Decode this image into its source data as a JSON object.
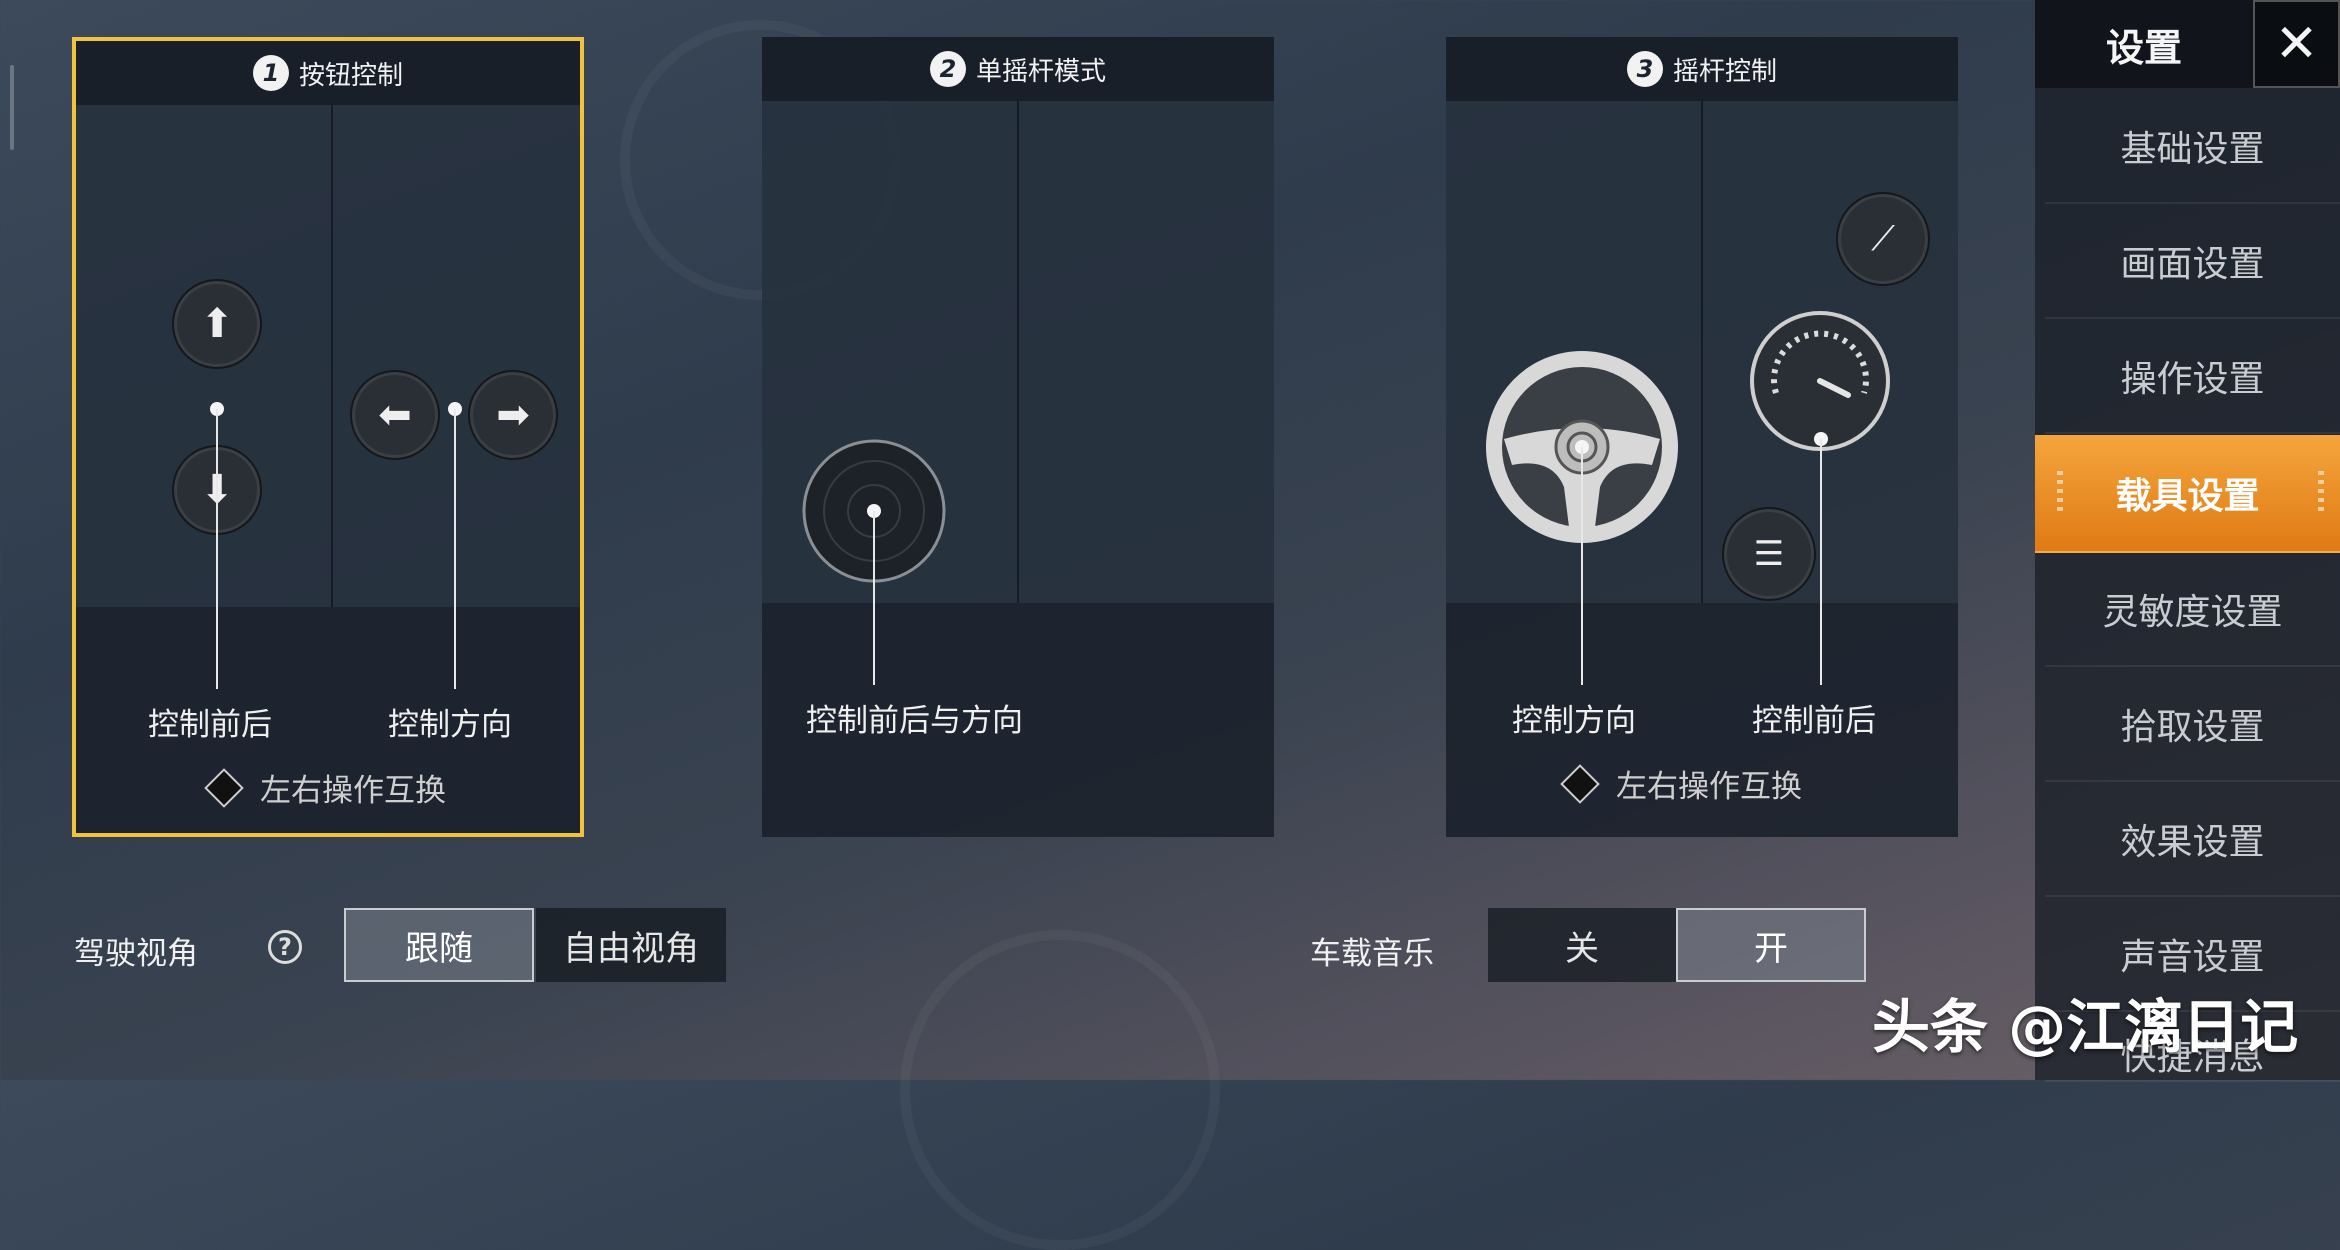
{
  "panels": [
    {
      "number": "1",
      "title": "按钮控制",
      "left_label": "控制前后",
      "right_label": "控制方向",
      "swap_label": "左右操作互换"
    },
    {
      "number": "2",
      "title": "单摇杆模式",
      "center_label": "控制前后与方向"
    },
    {
      "number": "3",
      "title": "摇杆控制",
      "left_label": "控制方向",
      "right_label": "控制前后",
      "swap_label": "左右操作互换"
    }
  ],
  "sidebar": {
    "title": "设置",
    "close_label": "✕",
    "items": [
      {
        "label": "基础设置"
      },
      {
        "label": "画面设置"
      },
      {
        "label": "操作设置"
      },
      {
        "label": "载具设置",
        "active": true
      },
      {
        "label": "灵敏度设置"
      },
      {
        "label": "拾取设置"
      },
      {
        "label": "效果设置"
      },
      {
        "label": "声音设置"
      },
      {
        "label": "快捷消息"
      }
    ]
  },
  "driving_view": {
    "label": "驾驶视角",
    "help": "?",
    "options": [
      "跟随",
      "自由视角"
    ],
    "selected": "跟随"
  },
  "car_music": {
    "label": "车载音乐",
    "options": [
      "关",
      "开"
    ],
    "selected": "开"
  },
  "watermark": "头条 @江漓日记",
  "colors": {
    "accent": "#f1c33c",
    "active_tab": "#ee8d25"
  }
}
